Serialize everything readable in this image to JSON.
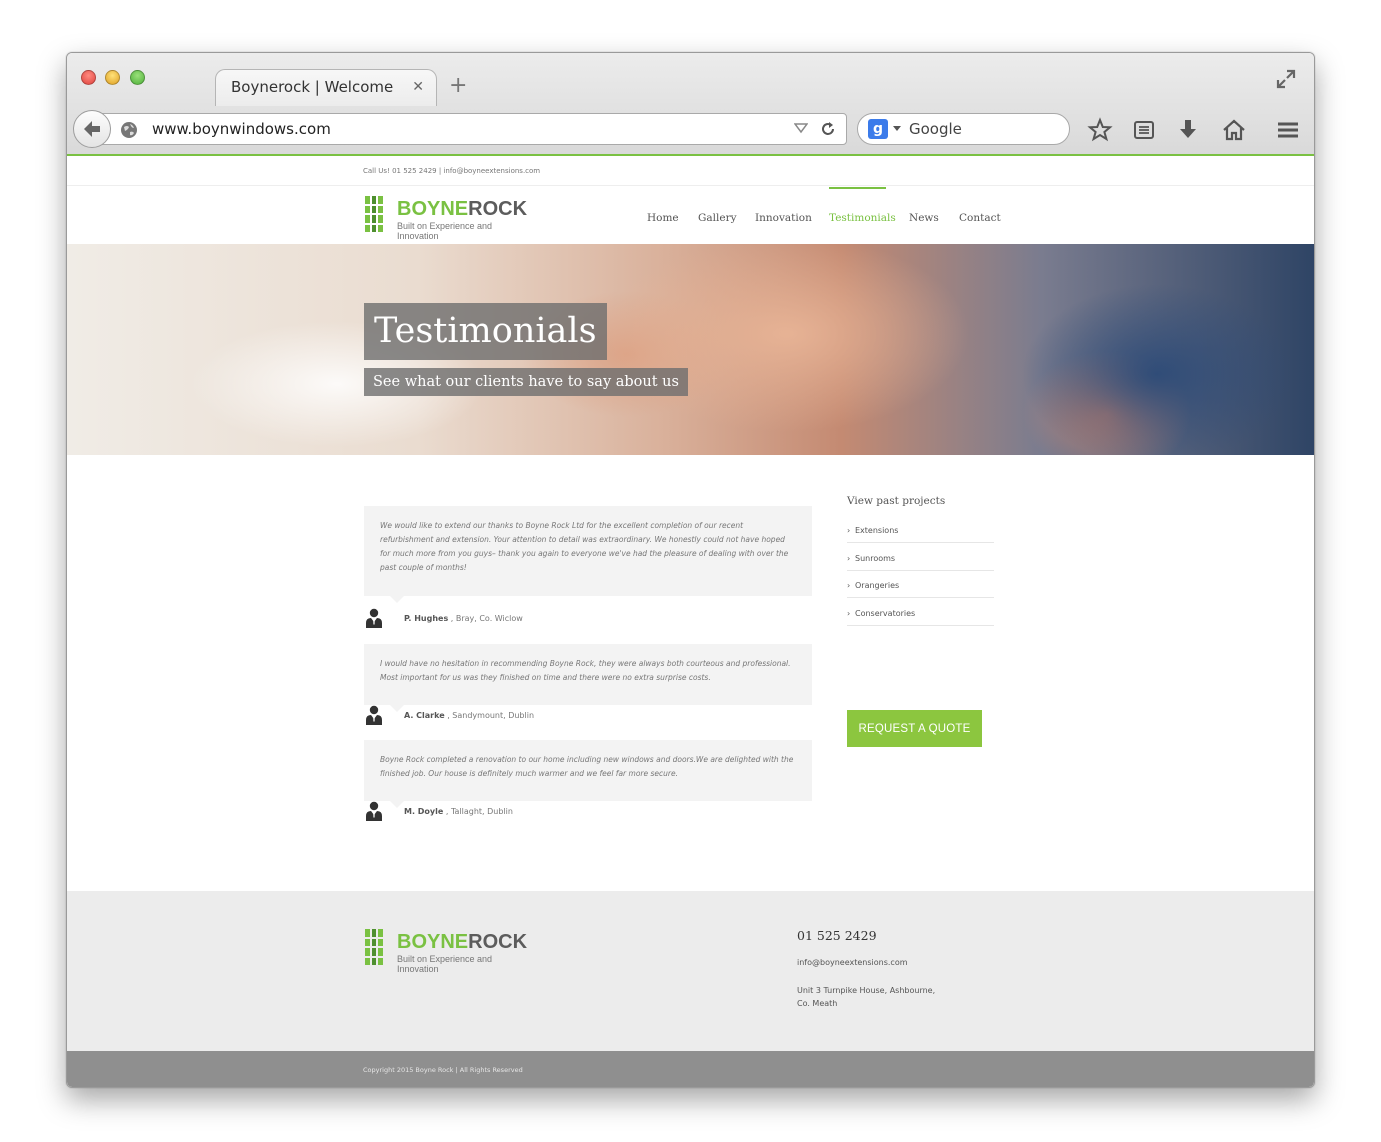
{
  "browser": {
    "tab_title": "Boynerock | Welcome",
    "url": "www.boynwindows.com",
    "search_engine": "Google",
    "accent_color": "#7ac142"
  },
  "topbar": {
    "contact_text": "Call Us! 01 525 2429  |  info@boyneextensions.com"
  },
  "logo": {
    "name_part1": "BOYNE",
    "name_part2": "ROCK",
    "tagline": "Built on Experience and Innovation"
  },
  "nav": {
    "items": [
      {
        "label": "Home",
        "active": false
      },
      {
        "label": "Gallery",
        "active": false
      },
      {
        "label": "Innovation",
        "active": false
      },
      {
        "label": "Testimonials",
        "active": true
      },
      {
        "label": "News",
        "active": false
      },
      {
        "label": "Contact",
        "active": false
      }
    ]
  },
  "hero": {
    "title": "Testimonials",
    "subtitle": "See what our clients have to say about us"
  },
  "testimonials": [
    {
      "quote": "We would like to extend our thanks to Boyne Rock Ltd for the excellent completion of our recent refurbishment and extension. Your attention to detail was extraordinary. We honestly could not have hoped for much more from you guys– thank you again to everyone we've had the pleasure of dealing with over the past couple of months!",
      "name": "P. Hughes",
      "location": " , Bray, Co. Wiclow"
    },
    {
      "quote": "I would have no hesitation in recommending Boyne Rock, they were always both courteous and professional. Most important for us was they finished on time and there were no extra surprise costs.",
      "name": "A. Clarke",
      "location": " , Sandymount, Dublin"
    },
    {
      "quote": "Boyne Rock completed a renovation to our home including new windows and doors.We are delighted with the finished job. Our house is definitely much warmer and we feel far more secure.",
      "name": "M. Doyle",
      "location": " , Tallaght, Dublin"
    }
  ],
  "sidebar": {
    "title": "View past projects",
    "links": [
      "Extensions",
      "Sunrooms",
      "Orangeries",
      "Conservatories"
    ],
    "button_label": "REQUEST A QUOTE",
    "button_color": "#8cc63f"
  },
  "footer": {
    "phone": "01 525 2429",
    "email": "info@boyneextensions.com",
    "address_line1": "Unit 3 Turnpike House, Ashbourne,",
    "address_line2": "Co. Meath",
    "copyright": "Copyright 2015 Boyne Rock | All Rights Reserved"
  }
}
